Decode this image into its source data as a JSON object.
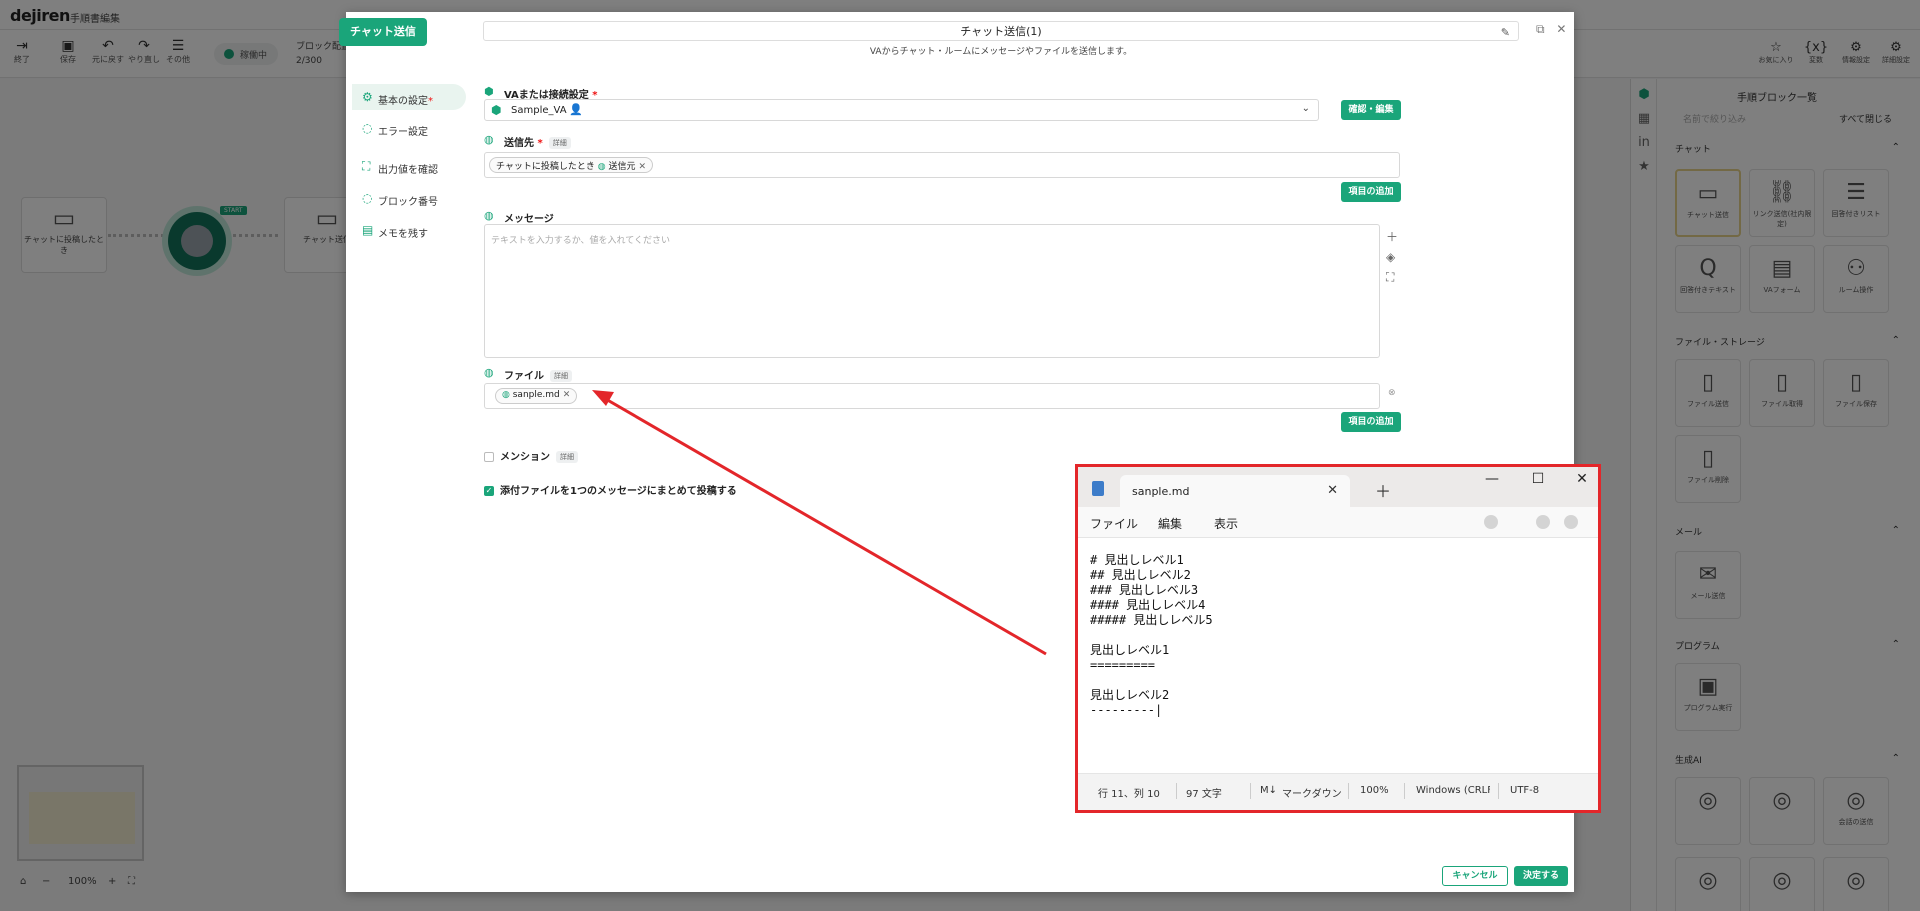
{
  "app": {
    "logo": "dejiren",
    "doc_title": "手順書編集",
    "toolbar": [
      {
        "icon": "exit-icon",
        "label": "終了"
      },
      {
        "icon": "save-icon",
        "label": "保存"
      },
      {
        "icon": "undo-icon",
        "label": "元に戻す"
      },
      {
        "icon": "redo-icon",
        "label": "やり直し"
      },
      {
        "icon": "menu-icon",
        "label": "その他"
      }
    ],
    "status_label": "稼働中",
    "block_count_label": "ブロック配置",
    "block_count": "2/300",
    "toolbar_right": [
      {
        "icon": "star-icon",
        "label": "お気に入り"
      },
      {
        "icon": "variable-icon",
        "label": "変数"
      },
      {
        "icon": "info-icon",
        "label": "情報設定"
      },
      {
        "icon": "settings-icon",
        "label": "詳細設定"
      }
    ]
  },
  "canvas": {
    "node1_label": "チャットに投稿したとき",
    "node2_label": "チャット送信",
    "start_tag": "START",
    "minimap_label": "",
    "zoom": "100%"
  },
  "right_panel": {
    "title": "手順ブロック一覧",
    "search_placeholder": "名前で絞り込み",
    "collapse_all": "すべて閉じる",
    "sections": [
      {
        "title": "チャット",
        "cards": [
          "チャット送信",
          "リンク送信(社内限定)",
          "回答付きリスト",
          "回答付きテキスト",
          "VAフォーム",
          "ルーム操作"
        ]
      },
      {
        "title": "ファイル・ストレージ",
        "cards": [
          "ファイル送信",
          "ファイル取得",
          "ファイル保存",
          "ファイル削除"
        ]
      },
      {
        "title": "メール",
        "cards": [
          "メール送信"
        ]
      },
      {
        "title": "プログラム",
        "cards": [
          "プログラム実行"
        ]
      },
      {
        "title": "生成AI",
        "cards": [
          "",
          "",
          "会話の送信"
        ]
      }
    ]
  },
  "dialog": {
    "badge": "チャット送信",
    "title": "チャット送信(1)",
    "subtitle": "VAからチャット・ルームにメッセージやファイルを送信します。",
    "menu": [
      {
        "label": "基本の設定",
        "required": "*",
        "icon": "gear-icon"
      },
      {
        "label": "エラー設定",
        "required": "",
        "icon": "error-icon"
      },
      {
        "label": "出力値を確認",
        "required": "",
        "icon": "output-icon"
      },
      {
        "label": "ブロック番号",
        "required": "",
        "icon": "number-icon"
      },
      {
        "label": "メモを残す",
        "required": "",
        "icon": "memo-icon"
      }
    ],
    "va_label": "VAまたは接続設定",
    "va_value": "Sample_VA",
    "va_button": "確認・編集",
    "dest_label": "送信先",
    "detail_chip": "詳細",
    "dest_chip_prefix": "チャットに投稿したとき",
    "dest_chip_value": "送信元",
    "add_item": "項目の追加",
    "message_label": "メッセージ",
    "message_placeholder": "テキストを入力するか、値を入れてください",
    "file_label": "ファイル",
    "file_chip": "sanple.md",
    "mention_label": "メンション",
    "attach_label": "添付ファイルを1つのメッセージにまとめて投稿する",
    "cancel": "キャンセル",
    "confirm": "決定する"
  },
  "notepad": {
    "tab_title": "sanple.md",
    "menu": [
      "ファイル",
      "編集",
      "表示"
    ],
    "lines": [
      "# 見出しレベル1",
      "## 見出しレベル2",
      "### 見出しレベル3",
      "#### 見出しレベル4",
      "##### 見出しレベル5",
      "",
      "見出しレベル1",
      "=========",
      "",
      "見出しレベル2",
      "---------|"
    ],
    "status": {
      "position": "行 11、列 10",
      "chars": "97 文字",
      "format": "マークダウン",
      "zoom": "100%",
      "line_ending": "Windows (CRLF)",
      "encoding": "UTF-8"
    }
  },
  "colors": {
    "accent": "#1aa57a",
    "highlight": "#e3262a"
  }
}
